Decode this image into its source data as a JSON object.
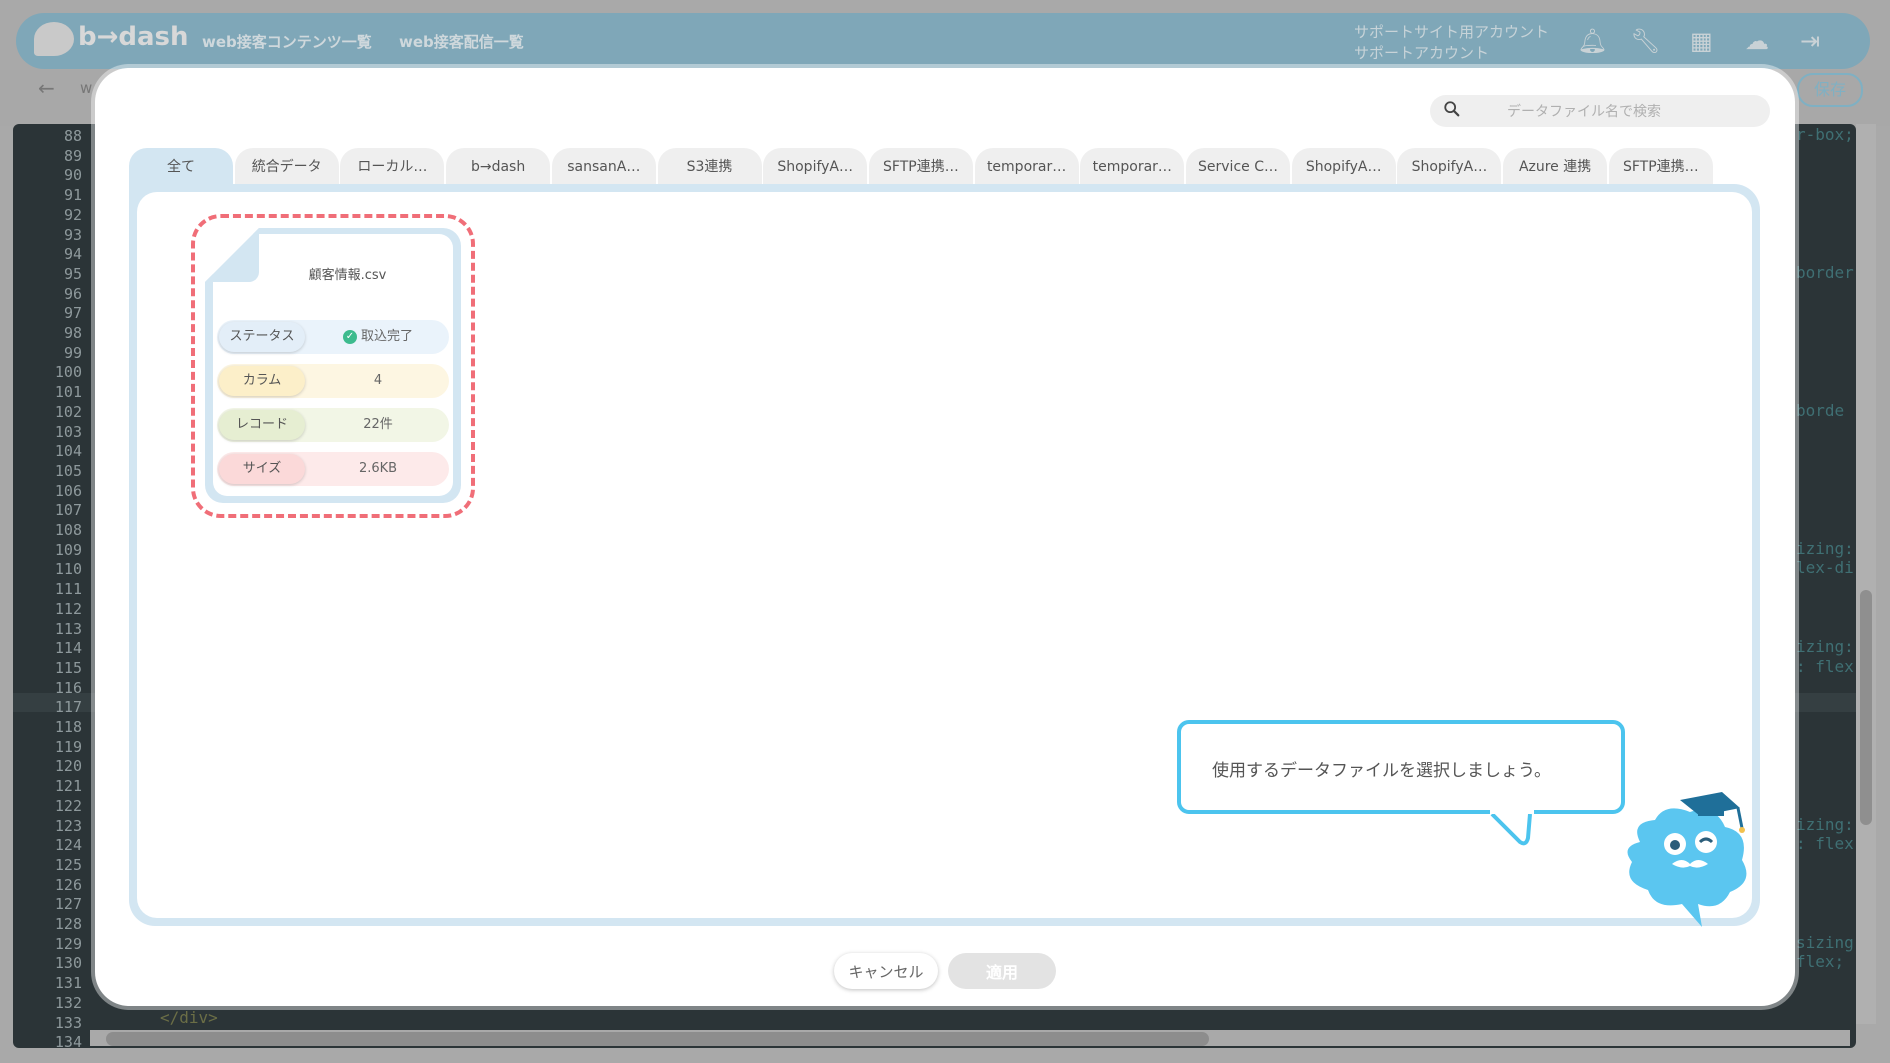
{
  "app": {
    "logo_text": "b→dash",
    "nav": [
      "web接客コンテンツ一覧",
      "web接客配信一覧"
    ],
    "account_line1": "サポートサイト用アカウント",
    "account_line2": "サポートアカウント",
    "subbar_text": "w",
    "save_label": "保存",
    "line_numbers": [
      "88",
      "89",
      "90",
      "91",
      "92",
      "93",
      "94",
      "95",
      "96",
      "97",
      "98",
      "99",
      "100",
      "101",
      "102",
      "103",
      "104",
      "105",
      "106",
      "107",
      "108",
      "109",
      "110",
      "111",
      "112",
      "113",
      "114",
      "115",
      "116",
      "117",
      "118",
      "119",
      "120",
      "121",
      "122",
      "123",
      "124",
      "125",
      "126",
      "127",
      "128",
      "129",
      "130",
      "131",
      "132",
      "133",
      "134"
    ],
    "code_right": [
      {
        "line": 0,
        "text": "r-box;"
      },
      {
        "line": 7,
        "text": "border"
      },
      {
        "line": 14,
        "text": "borde"
      },
      {
        "line": 21,
        "text": "izing:"
      },
      {
        "line": 22,
        "text": "lex-di"
      },
      {
        "line": 26,
        "text": "izing:"
      },
      {
        "line": 27,
        "text": ": flex"
      },
      {
        "line": 35,
        "text": "izing:"
      },
      {
        "line": 36,
        "text": ": flex"
      },
      {
        "line": 41,
        "text": "sizing"
      },
      {
        "line": 42,
        "text": "flex;"
      }
    ],
    "code_bottom": "</div>"
  },
  "modal": {
    "search": {
      "placeholder": "データファイル名で検索"
    },
    "tabs": [
      {
        "label": "全て",
        "active": true
      },
      {
        "label": "統合データ"
      },
      {
        "label": "ローカル…"
      },
      {
        "label": "b→dash"
      },
      {
        "label": "sansanA…"
      },
      {
        "label": "S3連携"
      },
      {
        "label": "ShopifyA…"
      },
      {
        "label": "SFTP連携…"
      },
      {
        "label": "temporar…"
      },
      {
        "label": "temporar…"
      },
      {
        "label": "Service C…"
      },
      {
        "label": "ShopifyA…"
      },
      {
        "label": "ShopifyA…"
      },
      {
        "label": "Azure 連携"
      },
      {
        "label": "SFTP連携…"
      }
    ],
    "file_card": {
      "name": "顧客情報.csv",
      "status_label": "ステータス",
      "status_value": "取込完了",
      "column_label": "カラム",
      "column_value": "4",
      "record_label": "レコード",
      "record_value": "22件",
      "size_label": "サイズ",
      "size_value": "2.6KB"
    },
    "guide_message": "使用するデータファイルを選択しましょう。",
    "cancel_label": "キャンセル",
    "apply_label": "適用"
  },
  "colors": {
    "accent_blue": "#4cc4ee",
    "panel_blue": "#d3e6f2",
    "dash_red": "#f06e78",
    "status_green": "#3dbb8e"
  }
}
